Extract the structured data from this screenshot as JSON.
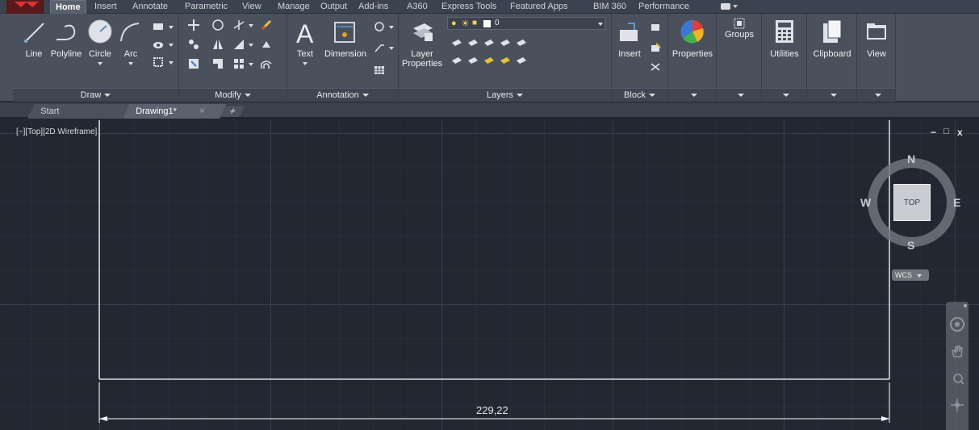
{
  "ribbon_tabs": [
    {
      "label": "Home",
      "active": true
    },
    {
      "label": "Insert"
    },
    {
      "label": "Annotate"
    },
    {
      "label": "Parametric"
    },
    {
      "label": "View"
    },
    {
      "label": "Manage"
    },
    {
      "label": "Output"
    },
    {
      "label": "Add-ins"
    },
    {
      "label": "A360"
    },
    {
      "label": "Express Tools"
    },
    {
      "label": "Featured Apps"
    },
    {
      "label": "BIM 360"
    },
    {
      "label": "Performance"
    }
  ],
  "panels": {
    "draw": {
      "title": "Draw",
      "line": "Line",
      "polyline": "Polyline",
      "circle": "Circle",
      "arc": "Arc"
    },
    "modify": {
      "title": "Modify"
    },
    "annotation": {
      "title": "Annotation",
      "text": "Text",
      "dimension": "Dimension"
    },
    "layers": {
      "title": "Layers",
      "layer_properties_1": "Layer",
      "layer_properties_2": "Properties",
      "current_layer": "0"
    },
    "block": {
      "title": "Block",
      "insert": "Insert"
    },
    "properties": {
      "label": "Properties"
    },
    "groups": {
      "label": "Groups"
    },
    "utilities": {
      "label": "Utilities"
    },
    "clipboard": {
      "label": "Clipboard"
    },
    "view": {
      "label": "View"
    }
  },
  "file_tabs": {
    "start": "Start",
    "drawing": "Drawing1*",
    "close_glyph": "×",
    "new_glyph": "+"
  },
  "viewport": {
    "label": "[−][Top][2D Wireframe]",
    "minimize": "−",
    "restore": "□",
    "close": "x"
  },
  "viewcube": {
    "face": "TOP",
    "north": "N",
    "south": "S",
    "east": "E",
    "west": "W",
    "ucs": "WCS"
  },
  "dimension": {
    "value": "229,22"
  },
  "colors": {
    "canvas_bg": "#212832",
    "ribbon_bg": "#4a515d",
    "drawing_line": "#ffffff"
  }
}
